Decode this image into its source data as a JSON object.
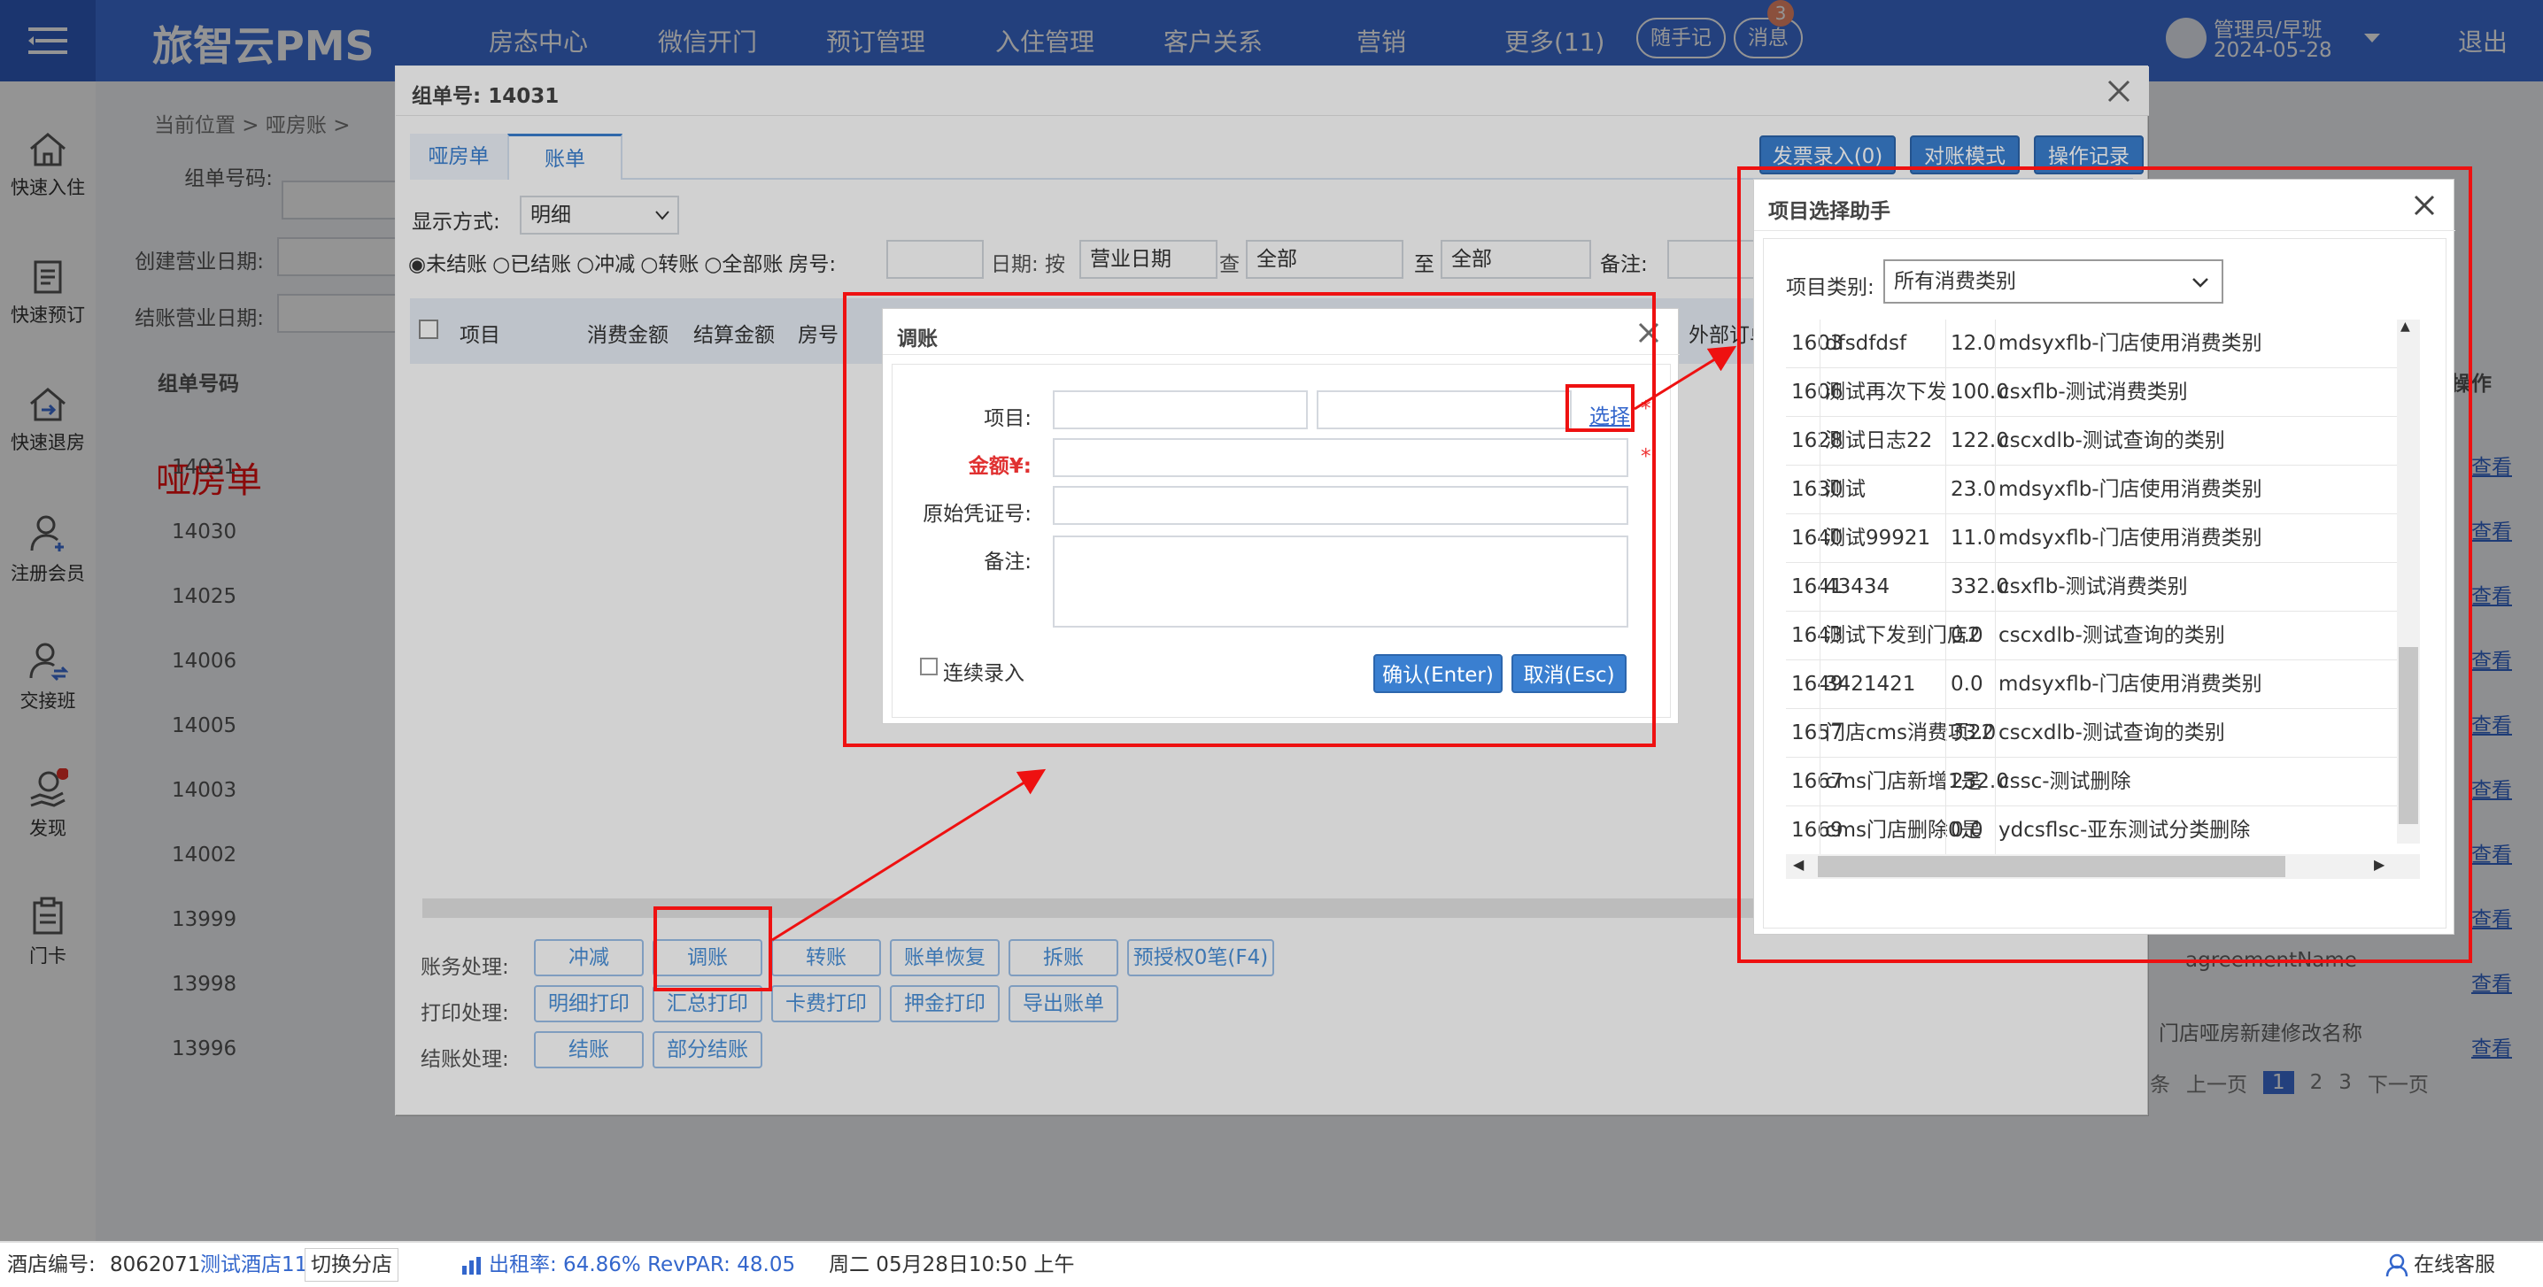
{
  "topbar": {
    "logo": "旅智云PMS",
    "nav": [
      "房态中心",
      "微信开门",
      "预订管理",
      "入住管理",
      "客户关系",
      "营销",
      "更多(11)"
    ],
    "notes_btn": "随手记",
    "msg_btn": "消息",
    "msg_badge": "3",
    "user_name": "管理员/早班",
    "user_date": "2024-05-28",
    "logout": "退出"
  },
  "sidebar": [
    "快速入住",
    "快速预订",
    "快速退房",
    "注册会员",
    "交接班",
    "发现",
    "门卡"
  ],
  "bg": {
    "breadcrumb": "当前位置 > 哑房账 >",
    "labels": [
      "组单号码:",
      "创建营业日期:",
      "结账营业日期:"
    ],
    "col_header": "组单号码",
    "action_header": "操作",
    "annotation": "哑房单",
    "rows": [
      "14031",
      "14030",
      "14025",
      "14006",
      "14005",
      "14003",
      "14002",
      "13999",
      "13998",
      "13996"
    ],
    "row_link": "查看",
    "agreement": "agreementName",
    "room_name": "门店哑房新建修改名称",
    "pager": {
      "per_page": "条",
      "prev": "上一页",
      "pages": [
        "1",
        "2",
        "3"
      ],
      "next": "下一页"
    }
  },
  "group_dialog": {
    "title": "组单号: 14031",
    "tabs": [
      "哑房单",
      "账单"
    ],
    "top_buttons": [
      "发票录入(0)",
      "对账模式",
      "操作记录"
    ],
    "display_label": "显示方式:",
    "display_value": "明细",
    "filters": {
      "radios": [
        "未结账",
        "已结账",
        "冲减",
        "转账",
        "全部账"
      ],
      "room_label": "房号:",
      "date_label": "日期: 按",
      "date_type": "营业日期",
      "check_label": "查",
      "from_value": "全部",
      "to_label": "至",
      "to_value": "全部",
      "note_label": "备注:"
    },
    "columns": [
      "项目",
      "消费金额",
      "结算金额",
      "房号"
    ],
    "outside_col": "外部订单",
    "actions": {
      "row1_label": "账务处理:",
      "row1": [
        "冲减",
        "调账",
        "转账",
        "账单恢复",
        "拆账",
        "预授权0笔(F4)"
      ],
      "row2_label": "打印处理:",
      "row2": [
        "明细打印",
        "汇总打印",
        "卡费打印",
        "押金打印",
        "导出账单"
      ],
      "row3_label": "结账处理:",
      "row3": [
        "结账",
        "部分结账"
      ]
    }
  },
  "adjust_dialog": {
    "title": "调账",
    "item_label": "项目:",
    "select_link": "选择",
    "amount_label": "金额¥:",
    "voucher_label": "原始凭证号:",
    "note_label": "备注:",
    "continuous_label": "连续录入",
    "confirm": "确认(Enter)",
    "cancel": "取消(Esc)",
    "required": "*"
  },
  "picker_dialog": {
    "title": "项目选择助手",
    "category_label": "项目类别:",
    "category_value": "所有消费类别",
    "rows": [
      {
        "id": "1603",
        "name": "dfsdfdsf",
        "amount": "12.0",
        "category": "mdsyxflb-门店使用消费类别"
      },
      {
        "id": "1606",
        "name": "测试再次下发",
        "amount": "100.0",
        "category": "csxflb-测试消费类别"
      },
      {
        "id": "1628",
        "name": "测试日志22",
        "amount": "122.0",
        "category": "cscxdlb-测试查询的类别"
      },
      {
        "id": "1630",
        "name": "测试",
        "amount": "23.0",
        "category": "mdsyxflb-门店使用消费类别"
      },
      {
        "id": "1640",
        "name": "测试99921",
        "amount": "11.0",
        "category": "mdsyxflb-门店使用消费类别"
      },
      {
        "id": "1641",
        "name": "43434",
        "amount": "332.0",
        "category": "csxflb-测试消费类别"
      },
      {
        "id": "1643",
        "name": "测试下发到门店2",
        "amount": "0.0",
        "category": "cscxdlb-测试查询的类别"
      },
      {
        "id": "1649",
        "name": "3421421",
        "amount": "0.0",
        "category": "mdsyxflb-门店使用消费类别"
      },
      {
        "id": "1657",
        "name": "门店cms消费项22",
        "amount": "33.0",
        "category": "cscxdlb-测试查询的类别"
      },
      {
        "id": "1667",
        "name": "cms门店新增1是",
        "amount": "232.0",
        "category": "cssc-测试删除"
      },
      {
        "id": "1669",
        "name": "cms门店删除0是",
        "amount": "0.0",
        "category": "ydcsflsc-亚东测试分类删除"
      }
    ]
  },
  "statusbar": {
    "hotel_no_label": "酒店编号:",
    "hotel_no": "8062071",
    "hotel_name": "测试酒店11",
    "switch": "切换分店",
    "occupancy": "出租率: 64.86% RevPAR: 48.05",
    "datetime": "周二 05月28日10:50 上午",
    "service": "在线客服"
  },
  "colors": {
    "primary": "#3d6fd8",
    "annotation_red": "#ee1111",
    "button_blue": "#3a7fd0"
  }
}
